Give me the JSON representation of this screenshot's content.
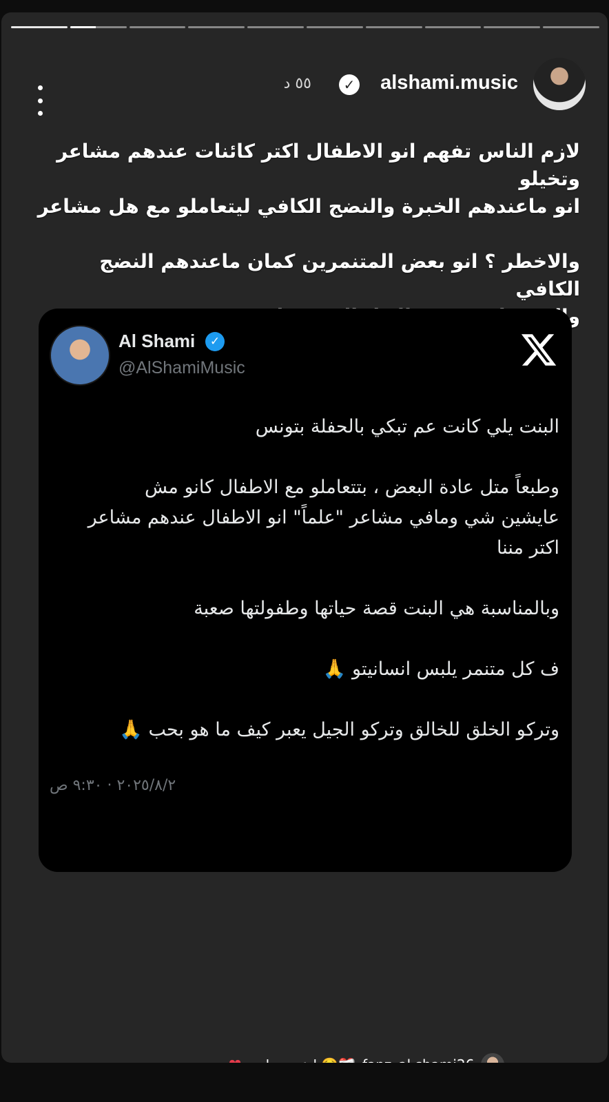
{
  "story": {
    "segments_total": 10,
    "current_segment": 2,
    "current_segment_progress": 0.45
  },
  "header": {
    "username": "alshami.music",
    "time_ago": "٥٥ د",
    "verified": true,
    "avatar_icon": "profile-avatar",
    "more_icon": "more-vertical-icon"
  },
  "caption": {
    "lines_1": [
      "لازم الناس تفهم انو الاطفال اكتر كائنات عندهم مشاعر وتخيلو",
      "انو ماعندهم الخبرة والنضج الكافي ليتعاملو مع هل مشاعر"
    ],
    "lines_2": [
      "والاخطر ؟ انو بعض المتنمرين كمان ماعندهم النضج الكافي",
      "والفهم لا يتفهمو الاطفال ومشاعرهم"
    ]
  },
  "tweet": {
    "name": "Al Shami",
    "handle": "@AlShamiMusic",
    "logo_icon": "x-logo-icon",
    "verified_color": "#1d9bf0",
    "p1": "البنت يلي كانت عم تبكي بالحفلة بتونس",
    "p2_lines": [
      "وطبعاً متل عادة البعض ، بتتعاملو مع الاطفال كانو مش",
      "عايشين شي ومافي مشاعر \"علماً\" انو الاطفال عندهم مشاعر",
      "اكتر مننا"
    ],
    "p3": "وبالمناسبة هي البنت قصة حياتها وطفولتها صعبة",
    "p4": "ف كل متنمر يلبس انسانيتو 🙏",
    "p5": "وتركو الخلق للخالق وتركو الجيل يعبر كيف ما هو بحب 🙏",
    "date": "٢٠٢٥/٨/٢ · ٩:٣٠ ص"
  },
  "mention": {
    "username": "fanz_al.shami26",
    "text": "يا عيوني انت🥺❤️‍🩹",
    "heart_color": "#e33b4b"
  }
}
